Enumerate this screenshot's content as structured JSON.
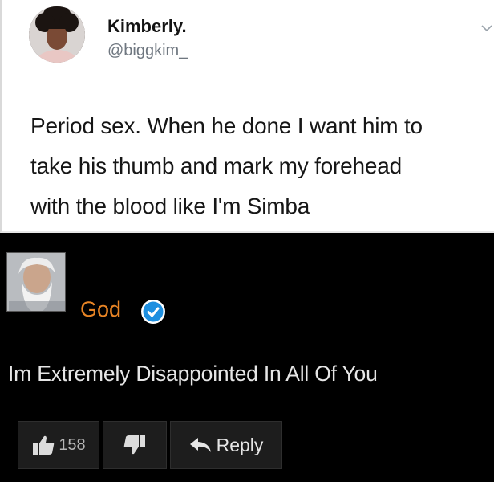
{
  "tweet": {
    "name": "Kimberly.",
    "handle": "@biggkim_",
    "text_lines": [
      "Period sex. When he done I want him to",
      "take his thumb and mark my forehead",
      "with the blood like I'm Simba"
    ]
  },
  "comment": {
    "author": "God",
    "verified": true,
    "text": "Im Extremely Disappointed In All Of You",
    "actions": {
      "like_count": "158",
      "reply_label": "Reply"
    }
  },
  "colors": {
    "tweet_background": "#ffffff",
    "comment_background": "#000000",
    "author_orange": "#e98525",
    "verified_blue": "#1d8fe0"
  },
  "icons": {
    "tweet_menu": "chevron-down-icon",
    "verified": "verified-check-icon",
    "like": "thumbs-up-icon",
    "dislike": "thumbs-down-icon",
    "reply": "reply-arrow-icon"
  }
}
